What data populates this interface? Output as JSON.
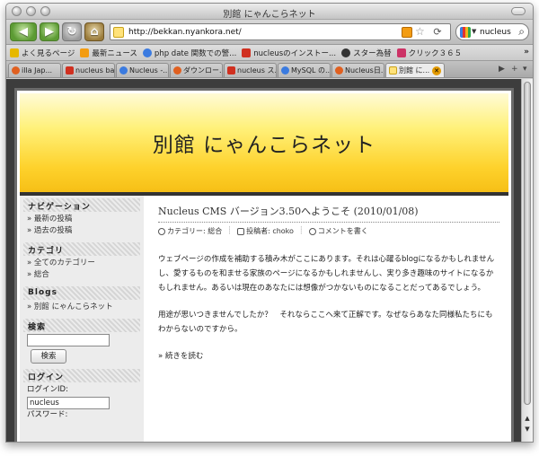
{
  "window": {
    "title": "別館 にゃんこらネット"
  },
  "toolbar": {
    "url": "http://bekkan.nyankora.net/",
    "search_value": "nucleus",
    "search_engine_icon": "google-icon"
  },
  "bookmarks": {
    "items": [
      {
        "label": "よく見るページ",
        "icon": "bookmark-icon",
        "color": "#e6b800"
      },
      {
        "label": "最新ニュース",
        "icon": "rss-feed-icon",
        "color": "#f39c12"
      },
      {
        "label": "php date 関数での警...",
        "icon": "globe-icon",
        "color": "#3b7be0"
      },
      {
        "label": "nucleusのインストー...",
        "icon": "nucleus-icon",
        "color": "#d03020"
      },
      {
        "label": "スター為替",
        "icon": "star-icon",
        "color": "#333333"
      },
      {
        "label": "クリック３６５",
        "icon": "click-icon",
        "color": "#cc3366"
      }
    ],
    "more": "»"
  },
  "tabs": {
    "items": [
      {
        "label": "illa Jap...",
        "color": "#e06020"
      },
      {
        "label": "nucleus ba...",
        "color": "#d03020"
      },
      {
        "label": "Nucleus -...",
        "color": "#3b7be0"
      },
      {
        "label": "ダウンロー...",
        "color": "#e06020"
      },
      {
        "label": "nucleus ス...",
        "color": "#d03020"
      },
      {
        "label": "MySQL の...",
        "color": "#3b7be0"
      },
      {
        "label": "Nucleus日...",
        "color": "#e06020"
      }
    ],
    "active_label": "別館 に...",
    "nav_left": "◀",
    "nav_right": "▶",
    "new_tab": "+",
    "menu": "▾"
  },
  "site": {
    "title": "別館 にゃんこらネット"
  },
  "sidebar": {
    "nav": {
      "heading": "ナビゲーション",
      "links": [
        "» 最新の投稿",
        "» 過去の投稿"
      ]
    },
    "category": {
      "heading": "カテゴリ",
      "links": [
        "» 全てのカテゴリー",
        "» 総合"
      ]
    },
    "blogs": {
      "heading": "Blogs",
      "links": [
        "» 別館 にゃんこらネット"
      ]
    },
    "search": {
      "heading": "検索",
      "input_value": "",
      "button_label": "検索"
    },
    "login": {
      "heading": "ログイン",
      "id_label": "ログインID:",
      "id_value": "nucleus",
      "password_label": "パスワード:"
    }
  },
  "post": {
    "title": "Nucleus CMS バージョン3.50へようこそ (2010/01/08)",
    "category": "カテゴリー: 総合",
    "author": "投稿者: choko",
    "comment": "コメントを書く",
    "paragraphs": [
      "ウェブページの作成を補助する積み木がここにあります。それは心躍るblogになるかもしれませんし、愛するものを和ませる家族のページになるかもしれませんし、実り多き趣味のサイトになるかもしれません。あるいは現在のあなたには想像がつかないものになることだってあるでしょう。",
      "用途が思いつきませんでしたか？　それならここへ来て正解です。なぜならあなた同様私たちにもわからないのですから。"
    ],
    "more": "» 続きを読む"
  }
}
